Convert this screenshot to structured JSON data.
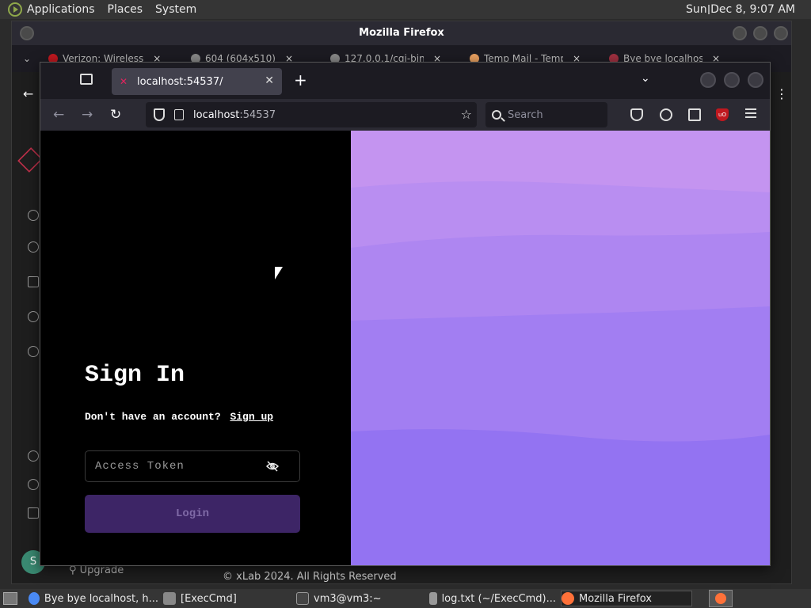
{
  "top_panel": {
    "menus": [
      "Applications",
      "Places",
      "System"
    ],
    "clock": "Sun Dec  8,  9:07 AM"
  },
  "background_window": {
    "title": "Mozilla Firefox",
    "tabs": [
      "Verizon: Wireless",
      "604 (604x510)",
      "127.0.0.1/cgi-bin/",
      "Temp Mail - Temp",
      "Bye bye localhost"
    ],
    "upgrade_label": "Upgrade",
    "avatar_initial": "S",
    "footer": "©  xLab  2024. All Rights Reserved"
  },
  "browser": {
    "tab_title": "localhost:54537/",
    "url_host": "localhost",
    "url_port": ":54537",
    "search_placeholder": "Search"
  },
  "signin": {
    "title": "Sign In",
    "prompt": "Don't have an account?",
    "signup_link": "Sign up",
    "token_placeholder": "Access Token",
    "login_label": "Login"
  },
  "taskbar": {
    "items": [
      "Bye bye localhost, h...",
      "[ExecCmd]",
      "vm3@vm3:~",
      "log.txt (~/ExecCmd)...",
      "Mozilla Firefox"
    ]
  },
  "colors": {
    "accent_purple": "#8b6cf0",
    "login_button": "#3d2566"
  }
}
